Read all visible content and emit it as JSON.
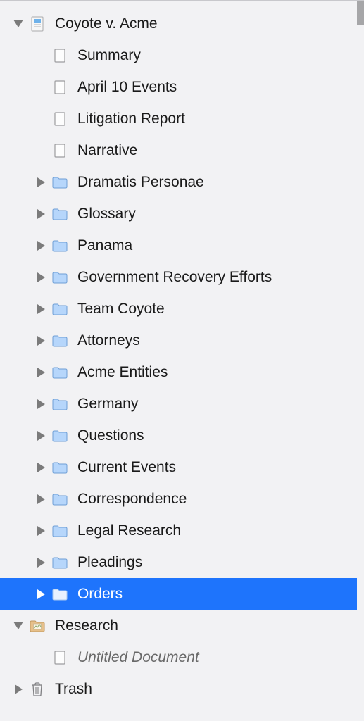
{
  "tree": {
    "root": {
      "label": "Coyote v. Acme",
      "docs": [
        {
          "label": "Summary"
        },
        {
          "label": "April 10 Events"
        },
        {
          "label": "Litigation Report"
        },
        {
          "label": "Narrative"
        }
      ],
      "folders": [
        {
          "label": "Dramatis Personae"
        },
        {
          "label": "Glossary"
        },
        {
          "label": "Panama"
        },
        {
          "label": "Government Recovery Efforts"
        },
        {
          "label": "Team Coyote"
        },
        {
          "label": "Attorneys"
        },
        {
          "label": "Acme Entities"
        },
        {
          "label": "Germany"
        },
        {
          "label": "Questions"
        },
        {
          "label": "Current Events"
        },
        {
          "label": "Correspondence"
        },
        {
          "label": "Legal Research"
        },
        {
          "label": "Pleadings"
        },
        {
          "label": "Orders",
          "selected": true
        }
      ]
    },
    "research": {
      "label": "Research",
      "children": [
        {
          "label": "Untitled Document",
          "italic": true
        }
      ]
    },
    "trash": {
      "label": "Trash"
    }
  }
}
